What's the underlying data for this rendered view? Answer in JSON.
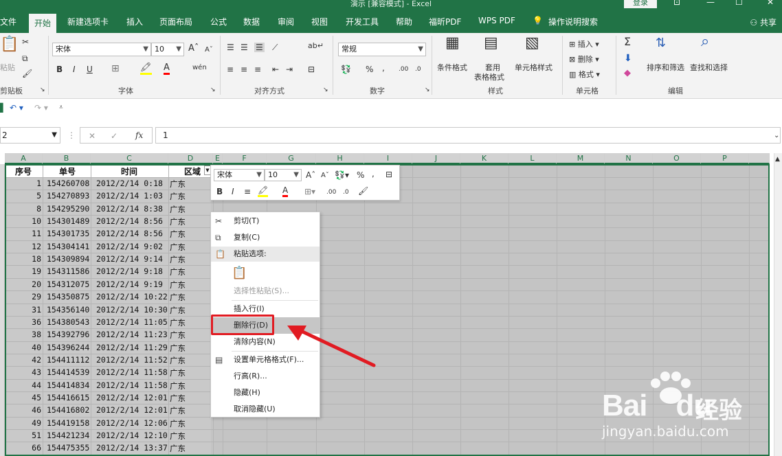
{
  "window": {
    "title": "演示 [兼容模式] - Excel",
    "login": "登录"
  },
  "tabs": [
    "文件",
    "开始",
    "新建选项卡",
    "插入",
    "页面布局",
    "公式",
    "数据",
    "审阅",
    "视图",
    "开发工具",
    "帮助",
    "福昕PDF",
    "WPS PDF",
    "操作说明搜索"
  ],
  "share": "共享",
  "ribbon": {
    "clipboard": {
      "paste": "粘贴",
      "label": "剪贴板"
    },
    "font": {
      "name": "宋体",
      "size": "10",
      "label": "字体",
      "bold": "B",
      "italic": "I",
      "underline": "U",
      "grow": "A",
      "shrink": "A",
      "wen": "wén"
    },
    "align": {
      "label": "对齐方式"
    },
    "number": {
      "format": "常规",
      "label": "数字",
      "percent": "%",
      "comma": ",",
      "dec_inc": ".00",
      "dec_dec": ".0"
    },
    "styles": {
      "cond": "条件格式",
      "table1": "套用",
      "table2": "表格格式",
      "cell": "单元格样式",
      "label": "样式"
    },
    "cells": {
      "insert": "插入",
      "delete": "删除",
      "format": "格式",
      "label": "单元格"
    },
    "editing": {
      "sort": "排序和筛选",
      "find": "查找和选择",
      "label": "编辑"
    }
  },
  "namebox": "2",
  "formula": "1",
  "columns": [
    "A",
    "B",
    "C",
    "D",
    "E",
    "F",
    "G",
    "H",
    "I",
    "J",
    "K",
    "L",
    "M",
    "N",
    "O",
    "P"
  ],
  "headers": {
    "a": "序号",
    "b": "单号",
    "c": "时间",
    "d": "区域"
  },
  "rows": [
    {
      "n": "1",
      "id": "154260708",
      "t": "2012/2/14  0:18",
      "r": "广东"
    },
    {
      "n": "5",
      "id": "154270893",
      "t": "2012/2/14  1:03",
      "r": "广东"
    },
    {
      "n": "8",
      "id": "154295290",
      "t": "2012/2/14  8:38",
      "r": "广东"
    },
    {
      "n": "10",
      "id": "154301489",
      "t": "2012/2/14  8:56",
      "r": "广东"
    },
    {
      "n": "11",
      "id": "154301735",
      "t": "2012/2/14  8:56",
      "r": "广东"
    },
    {
      "n": "12",
      "id": "154304141",
      "t": "2012/2/14  9:02",
      "r": "广东"
    },
    {
      "n": "18",
      "id": "154309894",
      "t": "2012/2/14  9:14",
      "r": "广东"
    },
    {
      "n": "19",
      "id": "154311586",
      "t": "2012/2/14  9:18",
      "r": "广东"
    },
    {
      "n": "20",
      "id": "154312075",
      "t": "2012/2/14  9:19",
      "r": "广东"
    },
    {
      "n": "29",
      "id": "154350875",
      "t": "2012/2/14 10:22",
      "r": "广东"
    },
    {
      "n": "31",
      "id": "154356140",
      "t": "2012/2/14 10:30",
      "r": "广东"
    },
    {
      "n": "36",
      "id": "154380543",
      "t": "2012/2/14 11:05",
      "r": "广东"
    },
    {
      "n": "38",
      "id": "154392796",
      "t": "2012/2/14 11:23",
      "r": "广东"
    },
    {
      "n": "40",
      "id": "154396244",
      "t": "2012/2/14 11:29",
      "r": "广东"
    },
    {
      "n": "42",
      "id": "154411112",
      "t": "2012/2/14 11:52",
      "r": "广东"
    },
    {
      "n": "43",
      "id": "154414539",
      "t": "2012/2/14 11:58",
      "r": "广东"
    },
    {
      "n": "44",
      "id": "154414834",
      "t": "2012/2/14 11:58",
      "r": "广东"
    },
    {
      "n": "45",
      "id": "154416615",
      "t": "2012/2/14 12:01",
      "r": "广东"
    },
    {
      "n": "46",
      "id": "154416802",
      "t": "2012/2/14 12:01",
      "r": "广东"
    },
    {
      "n": "49",
      "id": "154419158",
      "t": "2012/2/14 12:06",
      "r": "广东"
    },
    {
      "n": "51",
      "id": "154421234",
      "t": "2012/2/14 12:10",
      "r": "广东"
    },
    {
      "n": "66",
      "id": "154475355",
      "t": "2012/2/14 13:37",
      "r": "广东"
    }
  ],
  "minitoolbar": {
    "font": "宋体",
    "size": "10",
    "percent": "%",
    "comma": ","
  },
  "contextmenu": {
    "cut": "剪切(T)",
    "copy": "复制(C)",
    "paste_options": "粘贴选项:",
    "paste_special": "选择性粘贴(S)...",
    "insert_row": "插入行(I)",
    "delete_row": "删除行(D)",
    "clear": "清除内容(N)",
    "format_cells": "设置单元格格式(F)...",
    "row_height": "行高(R)...",
    "hide": "隐藏(H)",
    "unhide": "取消隐藏(U)"
  },
  "watermark": {
    "brand": "Bai",
    "brand2": "du",
    "cn": "经验",
    "url": "jingyan.baidu.com"
  },
  "colors": {
    "excel_green": "#217346",
    "highlight_red": "#e11b22"
  }
}
